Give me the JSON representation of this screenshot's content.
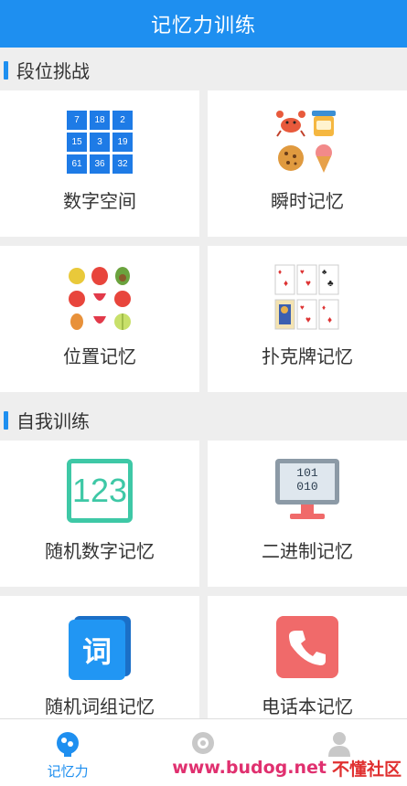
{
  "header": {
    "title": "记忆力训练"
  },
  "sections": [
    {
      "title": "段位挑战"
    },
    {
      "title": "自我训练"
    }
  ],
  "tiles": [
    {
      "label": "数字空间",
      "icon": "number-grid-icon",
      "grid": [
        "7",
        "18",
        "2",
        "15",
        "3",
        "19",
        "61",
        "36",
        "32"
      ]
    },
    {
      "label": "瞬时记忆",
      "icon": "food-items-icon"
    },
    {
      "label": "位置记忆",
      "icon": "fruit-grid-icon"
    },
    {
      "label": "扑克牌记忆",
      "icon": "playing-cards-icon"
    },
    {
      "label": "随机数字记忆",
      "icon": "digits-123-icon",
      "icon_text": "123"
    },
    {
      "label": "二进制记忆",
      "icon": "binary-monitor-icon",
      "icon_text_1": "101",
      "icon_text_2": "010"
    },
    {
      "label": "随机词组记忆",
      "icon": "word-book-icon",
      "icon_text": "词"
    },
    {
      "label": "电话本记忆",
      "icon": "phone-book-icon"
    }
  ],
  "bottom_nav": [
    {
      "label": "记忆力",
      "icon": "brain-icon",
      "active": true
    },
    {
      "label": "",
      "icon": "eye-icon",
      "active": false
    },
    {
      "label": "",
      "icon": "user-icon",
      "active": false
    }
  ],
  "watermark": {
    "url": "www.budog.net",
    "text": "不懂社区"
  },
  "colors": {
    "accent": "#1e8ff0",
    "background": "#eeeeee"
  }
}
